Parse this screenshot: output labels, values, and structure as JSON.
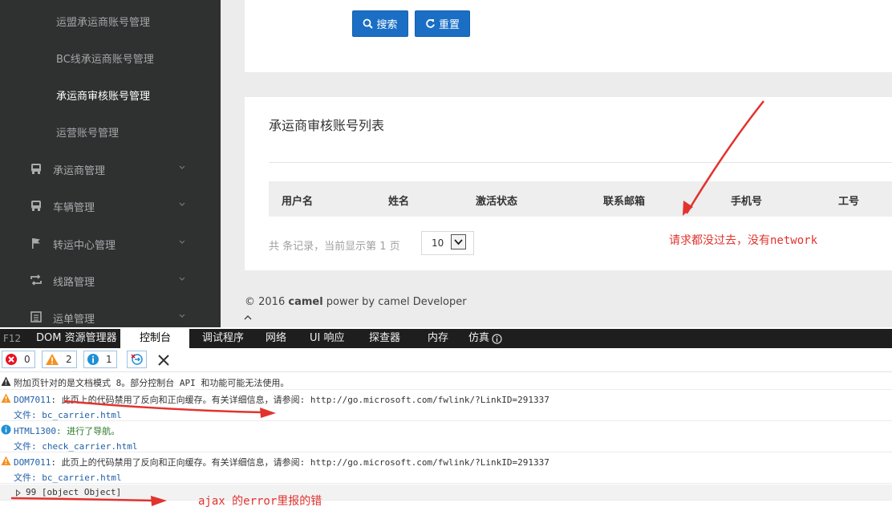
{
  "sidebar": {
    "sub_items": [
      {
        "label": "运盟承运商账号管理",
        "active": false
      },
      {
        "label": "BC线承运商账号管理",
        "active": false
      },
      {
        "label": "承运商审核账号管理",
        "active": true
      },
      {
        "label": "运营账号管理",
        "active": false
      }
    ],
    "menu_items": [
      {
        "label": "承运商管理",
        "icon": "bus-icon"
      },
      {
        "label": "车辆管理",
        "icon": "bus-icon"
      },
      {
        "label": "转运中心管理",
        "icon": "flag-icon"
      },
      {
        "label": "线路管理",
        "icon": "retweet-icon"
      },
      {
        "label": "运单管理",
        "icon": "list-icon"
      }
    ]
  },
  "search": {
    "search_label": "搜索",
    "reset_label": "重置"
  },
  "list": {
    "title": "承运商审核账号列表",
    "columns": [
      "用户名",
      "姓名",
      "激活状态",
      "联系邮箱",
      "手机号",
      "工号"
    ],
    "pager_info": "共 条记录，当前显示第  1 页",
    "page_size": "10"
  },
  "footer": {
    "prefix": "© 2016 ",
    "brand": "camel",
    "suffix": " power by camel Developer"
  },
  "annotations": {
    "network_note": "请求都没过去，没有network",
    "ajax_note": "ajax 的error里报的错"
  },
  "devtools": {
    "f12": "F12",
    "tabs": [
      "DOM 资源管理器",
      "控制台",
      "调试程序",
      "网络",
      "UI 响应",
      "探查器",
      "内存",
      "仿真"
    ],
    "active_tab": "控制台",
    "counts": {
      "errors": "0",
      "warnings": "2",
      "info": "1"
    },
    "colors": {
      "error": "#e81123",
      "warning": "#f7901e",
      "info": "#1e90d6"
    },
    "messages": [
      {
        "type": "warning",
        "text": "附加页针对的是文档模式 8。部分控制台 API 和功能可能无法使用。"
      },
      {
        "type": "warning",
        "code": "DOM7011",
        "text": ": 此页上的代码禁用了反向和正向缓存。有关详细信息，请参阅: http://go.microsoft.com/fwlink/?LinkID=291337",
        "file_label": "文件: ",
        "file": "bc_carrier.html"
      },
      {
        "type": "info",
        "code": "HTML1300",
        "text": ": 进行了导航。",
        "file_label": "文件: ",
        "file": "check_carrier.html"
      },
      {
        "type": "warning",
        "code": "DOM7011",
        "text": ": 此页上的代码禁用了反向和正向缓存。有关详细信息，请参阅: http://go.microsoft.com/fwlink/?LinkID=291337",
        "file_label": "文件: ",
        "file": "bc_carrier.html"
      },
      {
        "type": "log",
        "text": "99 [object Object]"
      }
    ]
  }
}
